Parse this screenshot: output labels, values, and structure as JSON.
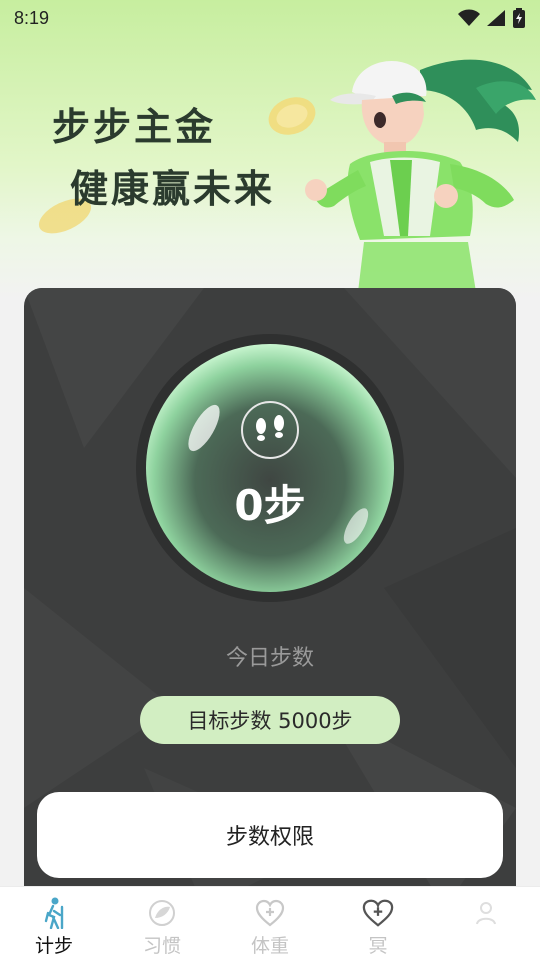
{
  "status_bar": {
    "time": "8:19"
  },
  "banner": {
    "line1": "步步主金",
    "line2": "健康赢未来"
  },
  "steps_card": {
    "steps_value": "0步",
    "today_label": "今日步数",
    "goal_text": "目标步数 5000步",
    "permission_button": "步数权限"
  },
  "bottom_nav": {
    "items": [
      {
        "label": "计步",
        "icon": "walking-icon",
        "active": true
      },
      {
        "label": "习惯",
        "icon": "leaf-icon",
        "active": false
      },
      {
        "label": "体重",
        "icon": "heart-plus-icon",
        "active": false
      },
      {
        "label": "冥",
        "icon": "heart-plus-icon",
        "active": false
      },
      {
        "label": "",
        "icon": "user-icon",
        "active": false
      }
    ]
  },
  "colors": {
    "banner_green": "#c7ee9f",
    "card_bg": "#3d3e3e",
    "goal_pill": "#d2eec2",
    "active_nav": "#111111",
    "inactive_nav": "#c4c4c4",
    "walking_icon": "#4aa6c8"
  }
}
